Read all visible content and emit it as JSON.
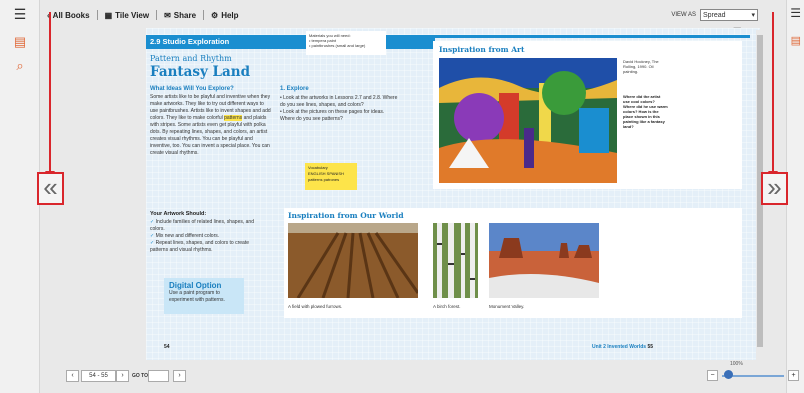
{
  "toolbar": {
    "all_books": "All Books",
    "tile_view": "Tile View",
    "share": "Share",
    "help": "Help",
    "view_as_label": "VIEW AS",
    "view_as_value": "Spread"
  },
  "book": {
    "section_label": "2.9 Studio Exploration",
    "materials": "Materials you will need:\n• tempera paint\n• paintbrushes (small and large)",
    "subtitle": "Pattern and Rhythm",
    "title": "Fantasy Land",
    "question": "What Ideas Will You Explore?",
    "intro": "Some artists like to be playful and inventive when they make artworks. They like to try out different ways to use paintbrushes. Artists like to invent shapes and add colors. They like to make colorful",
    "highlight_word": "patterns",
    "intro_tail": " and plaids with stripes. Some artists even get playful with polka dots. By repeating lines, shapes, and colors, an artist creates visual rhythms. You can be playful and inventive, too. You can invent a special place. You can create visual rhythms.",
    "explore_title": "1. Explore",
    "explore_body": "• Look at the artworks in Lessons 2.7 and 2.8. Where do you see lines, shapes, and colors?\n• Look at the pictures on these pages for ideas. Where do you see patterns?",
    "vocab": "Vocabulary\nENGLISH   SPANISH\npatterns   patrones",
    "your_artwork_title": "Your Artwork Should:",
    "your_artwork_items": [
      "Include families of related lines, shapes, and colors.",
      "Mix new and different colors.",
      "Repeat lines, shapes, and colors to create patterns and visual rhythms."
    ],
    "digital_title": "Digital Option",
    "digital_body": "Use a paint program to experiment with patterns.",
    "page_left": "54",
    "art_title": "Inspiration from Art",
    "art_caption": "David Hockney, The Rolling, 1990. Oil painting.",
    "art_question": "Where did the artist use cool colors? Where did he use warm colors? How is the place shown in this painting like a fantasy land?",
    "world_title": "Inspiration from Our World",
    "cap1": "A field with plowed furrows.",
    "cap2": "A birch forest.",
    "cap3": "Monument Valley.",
    "page_right_unit": "Unit 2 Invented Worlds",
    "page_right_num": "55"
  },
  "pager": {
    "pages": "54 - 55",
    "goto_label": "GO TO:"
  },
  "zoom": {
    "percent": "100%",
    "level": 0.1
  },
  "colors": {
    "accent": "#1a8ed0",
    "annotation_red": "#d9262c",
    "highlight": "#fde44a"
  }
}
